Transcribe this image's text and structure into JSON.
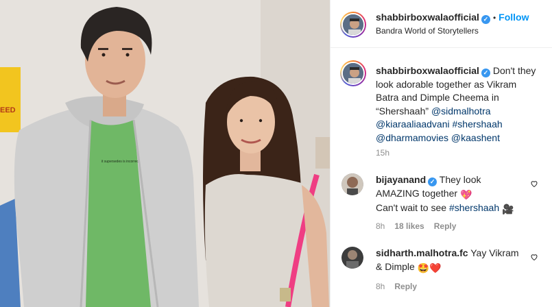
{
  "post": {
    "author": "shabbirboxwalaofficial",
    "verified_mark": "✓",
    "separator": "•",
    "follow_label": "Follow",
    "location": "Bandra World of Storytellers",
    "caption_text": "Don't they look adorable together as Vikram Batra and Dimple Cheema in “Shershaah”",
    "caption_mentions": [
      "@sidmalhotra",
      "@kiaraaliaadvani",
      "#shershaah",
      "@dharmamovies",
      "@kaashent"
    ],
    "posted_ago": "15h"
  },
  "photo": {
    "sign_text": "EED"
  },
  "comments": [
    {
      "username": "bijayanand",
      "verified": true,
      "text_1": "They look AMAZING together",
      "emoji_1": "💖",
      "text_2": "Can't wait to see",
      "hashtag": "#shershaah",
      "emoji_2": "🎥",
      "time": "8h",
      "likes": "18 likes",
      "reply_label": "Reply",
      "like_icon": "heart-outline-icon"
    },
    {
      "username": "sidharth.malhotra.fc",
      "verified": false,
      "text_1": "Yay Vikram & Dimple",
      "emoji_1": "🤩",
      "emoji_2": "❤️",
      "time": "8h",
      "reply_label": "Reply",
      "like_icon": "heart-outline-icon"
    }
  ],
  "colors": {
    "link": "#00376b",
    "follow": "#0095f6",
    "verified": "#3897f0",
    "muted": "#8e8e8e"
  }
}
